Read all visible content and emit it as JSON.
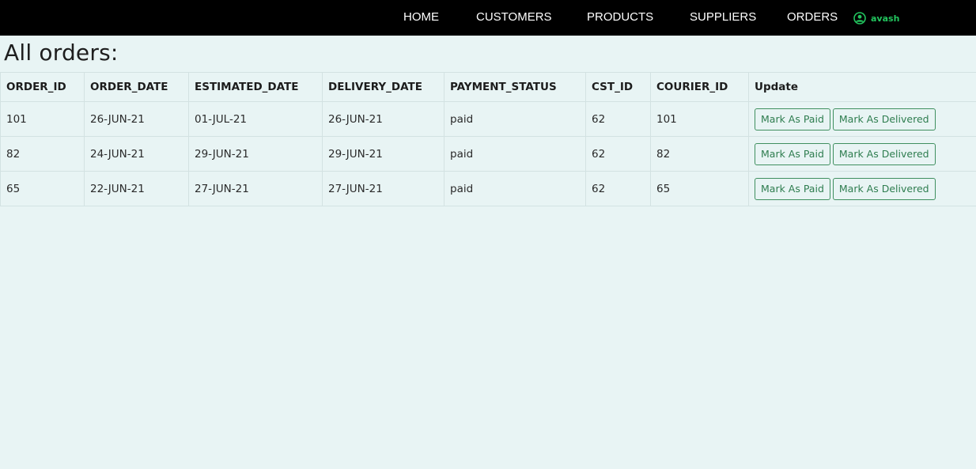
{
  "nav": {
    "links": [
      {
        "label": "HOME"
      },
      {
        "label": "CUSTOMERS"
      },
      {
        "label": "PRODUCTS"
      },
      {
        "label": "SUPPLIERS"
      },
      {
        "label": "ORDERS"
      }
    ],
    "user": {
      "name": "avash",
      "icon": "user-circle-icon",
      "color": "#22c55e"
    }
  },
  "page": {
    "title": "All orders:"
  },
  "table": {
    "headers": [
      "ORDER_ID",
      "ORDER_DATE",
      "ESTIMATED_DATE",
      "DELIVERY_DATE",
      "PAYMENT_STATUS",
      "CST_ID",
      "COURIER_ID",
      "Update"
    ],
    "rows": [
      [
        "101",
        "26-JUN-21",
        "01-JUL-21",
        "26-JUN-21",
        "paid",
        "62",
        "101"
      ],
      [
        "82",
        "24-JUN-21",
        "29-JUN-21",
        "29-JUN-21",
        "paid",
        "62",
        "82"
      ],
      [
        "65",
        "22-JUN-21",
        "27-JUN-21",
        "27-JUN-21",
        "paid",
        "62",
        "65"
      ]
    ],
    "actions": {
      "mark_paid": "Mark As Paid",
      "mark_delivered": "Mark As Delivered"
    }
  },
  "colors": {
    "nav_bg": "#000000",
    "page_bg": "#e8f4f4",
    "accent_green": "#22c55e",
    "button_green": "#2e7d4f"
  }
}
